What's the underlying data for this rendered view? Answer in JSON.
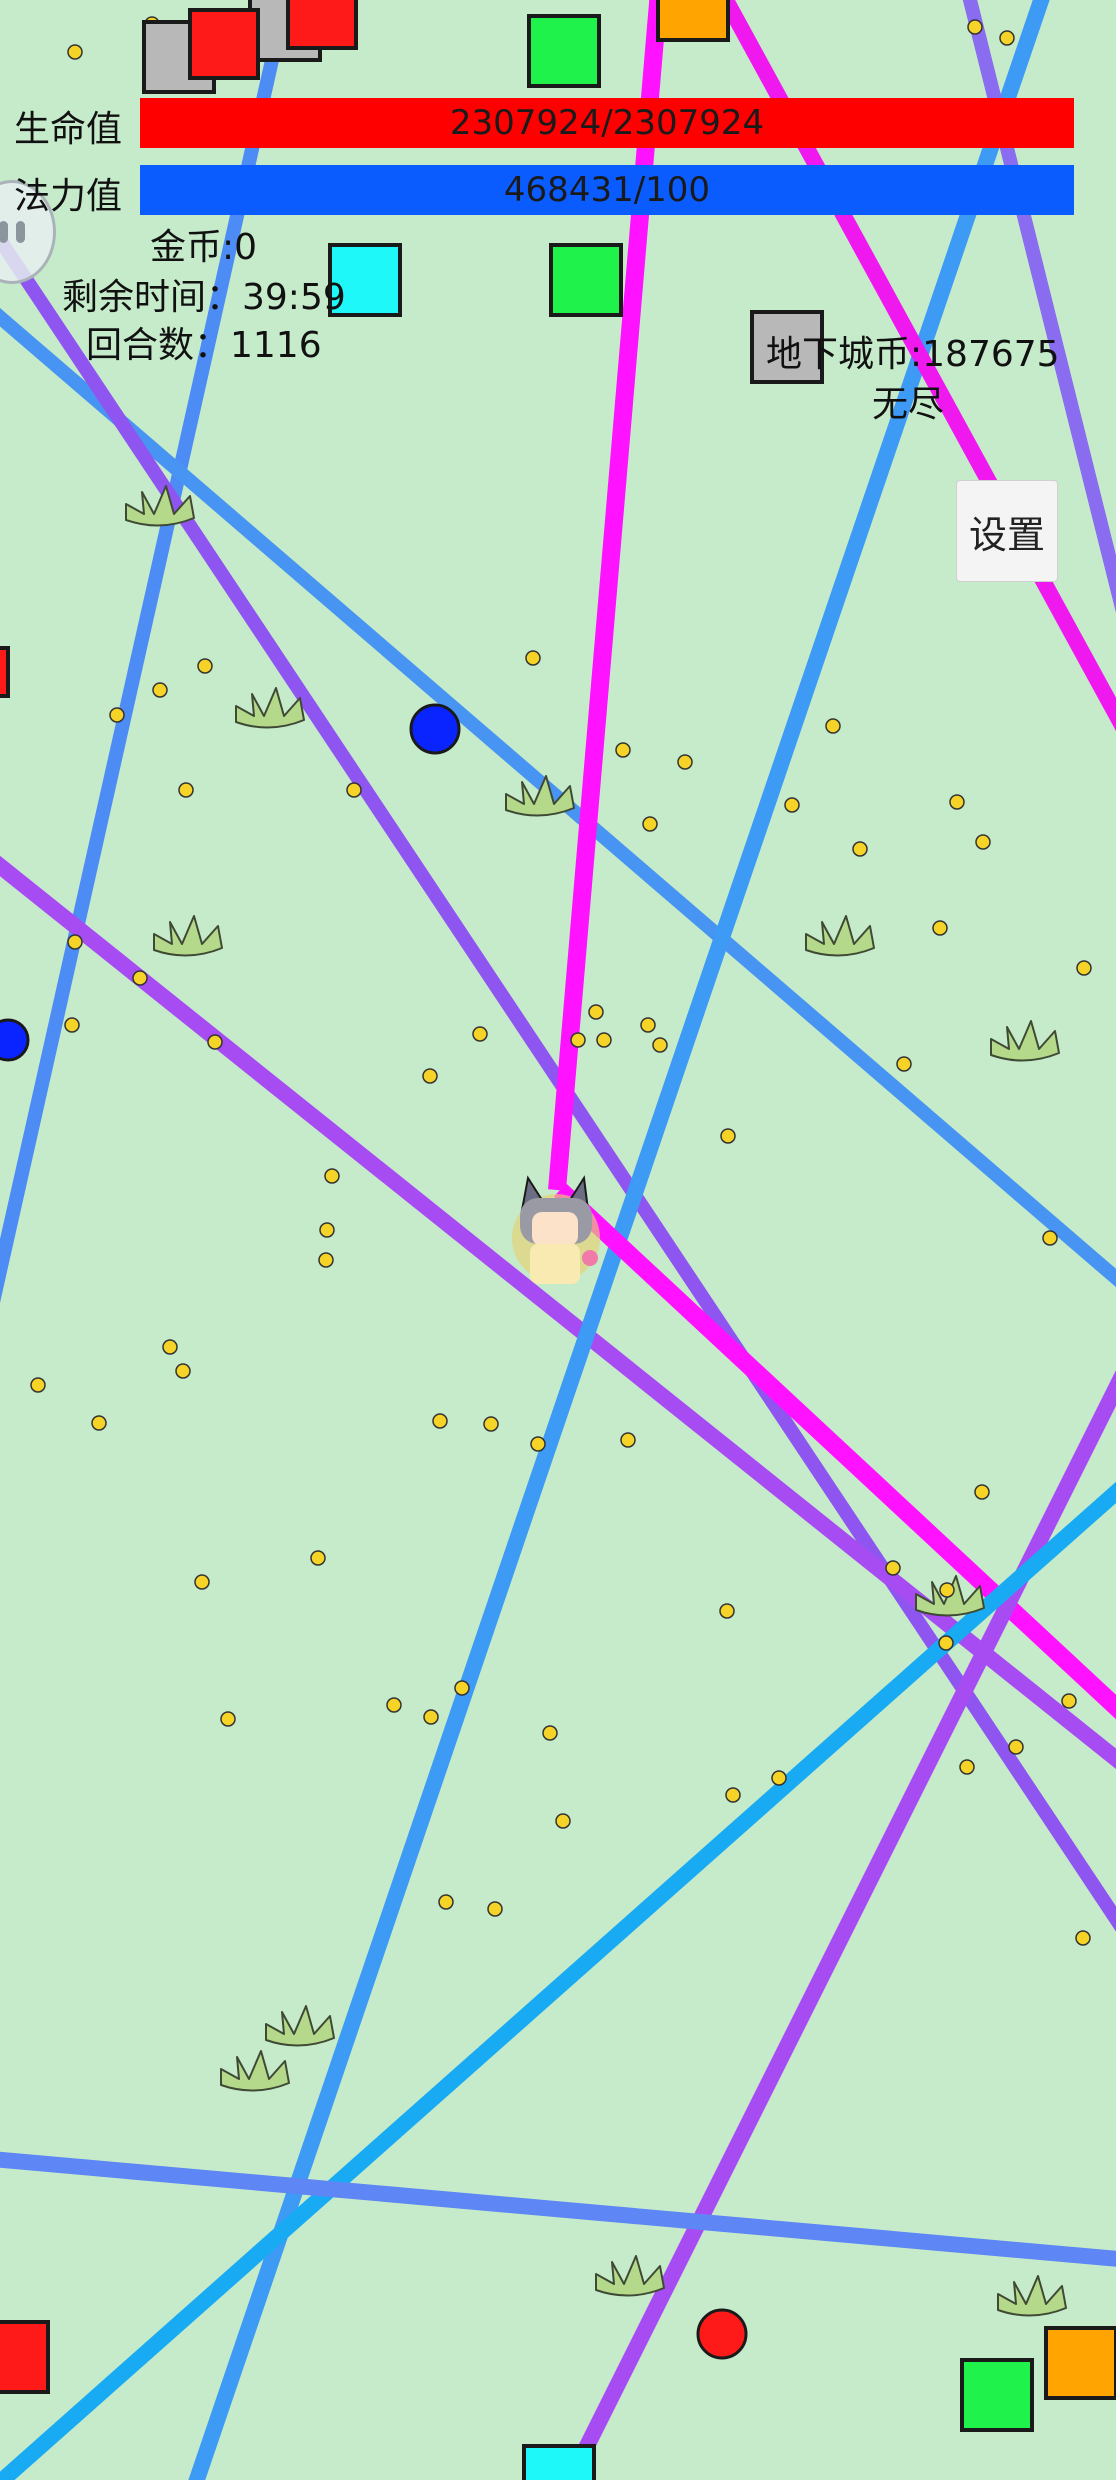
{
  "hud": {
    "hp_label": "生命值",
    "hp_value": "2307924/2307924",
    "mp_label": "法力值",
    "mp_value": "468431/100",
    "gold": "金币:0",
    "time_left": "剩余时间：39:59",
    "round": "回合数：1116",
    "dungeon_coins": "地下城币:187675",
    "mode": "无尽",
    "settings_label": "设置"
  },
  "colors": {
    "background": "#c6ebcb",
    "hp_bar": "#ff0000",
    "mp_bar": "#0b5cff",
    "coin": "#f6d327",
    "grass": "#b5d98a"
  },
  "player": {
    "sprite": "cat-eared-girl-character"
  },
  "icons": {
    "ghost": "ghost-face-icon",
    "grass": "grass-tuft-icon",
    "coin": "gold-coin-icon"
  }
}
